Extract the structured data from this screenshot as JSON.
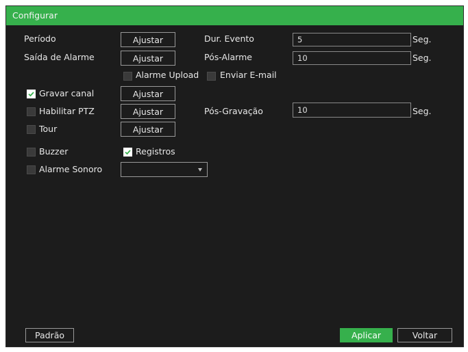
{
  "dialog": {
    "title": "Configurar"
  },
  "rows": {
    "periodo": {
      "label": "Período",
      "button": "Ajustar"
    },
    "saida_alarme": {
      "label": "Saída de Alarme",
      "button": "Ajustar"
    },
    "dur_evento": {
      "label": "Dur. Evento",
      "value": "5",
      "unit": "Seg."
    },
    "pos_alarme": {
      "label": "Pós-Alarme",
      "value": "10",
      "unit": "Seg."
    },
    "alarme_upload": {
      "label": "Alarme Upload",
      "checked": false
    },
    "enviar_email": {
      "label": "Enviar E-mail",
      "checked": false
    },
    "gravar_canal": {
      "label": "Gravar canal",
      "checked": true,
      "button": "Ajustar"
    },
    "habilitar_ptz": {
      "label": "Habilitar PTZ",
      "checked": false,
      "button": "Ajustar"
    },
    "pos_gravacao": {
      "label": "Pós-Gravação",
      "value": "10",
      "unit": "Seg."
    },
    "tour": {
      "label": "Tour",
      "checked": false,
      "button": "Ajustar"
    },
    "buzzer": {
      "label": "Buzzer",
      "checked": false
    },
    "registros": {
      "label": "Registros",
      "checked": true
    },
    "alarme_sonoro": {
      "label": "Alarme Sonoro",
      "checked": false,
      "selected": ""
    }
  },
  "footer": {
    "default_label": "Padrão",
    "apply_label": "Aplicar",
    "back_label": "Voltar"
  },
  "colors": {
    "accent": "#36b04c",
    "background": "#1c1c1c",
    "text": "#e8e8e8"
  }
}
